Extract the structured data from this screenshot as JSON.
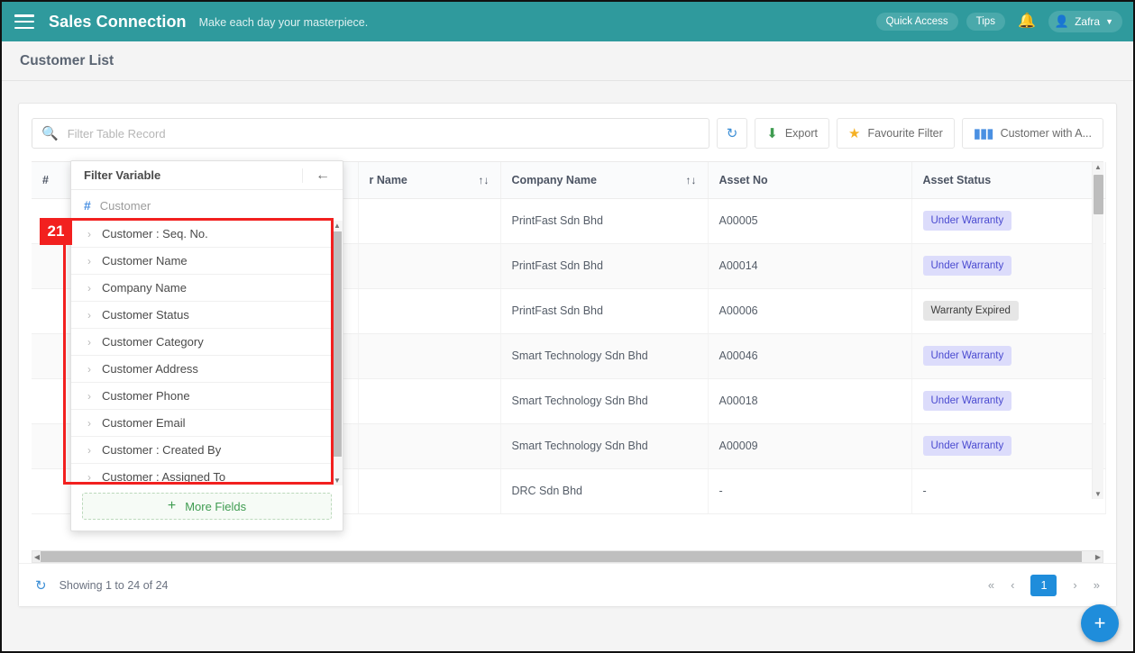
{
  "topbar": {
    "menu_icon": "hamburger-icon",
    "brand": "Sales Connection",
    "tagline": "Make each day your masterpiece.",
    "quick_access": "Quick Access",
    "tips": "Tips",
    "bell_icon": "bell-icon",
    "user_name": "Zafra",
    "teal": "#2f9a9d"
  },
  "page": {
    "title": "Customer List"
  },
  "toolbar": {
    "search_placeholder": "Filter Table Record",
    "search_value": "",
    "refresh_label": "",
    "export_label": "Export",
    "favourite_filter_label": "Favourite Filter",
    "columns_label": "Customer with A..."
  },
  "table": {
    "columns": [
      {
        "label": "#",
        "sortable": false
      },
      {
        "label": "",
        "sortable": false
      },
      {
        "label": "",
        "sortable": false
      },
      {
        "label": "r Name",
        "sortable": true
      },
      {
        "label": "Company Name",
        "sortable": true
      },
      {
        "label": "Asset No",
        "sortable": false
      },
      {
        "label": "Asset Status",
        "sortable": false
      }
    ],
    "sort_glyph": "↑↓",
    "rows": [
      {
        "hash": "",
        "icon": "",
        "a": "",
        "b": "",
        "name": "",
        "company": "PrintFast Sdn Bhd",
        "asset_no": "A00005",
        "status": "Under Warranty",
        "status_type": "warranty"
      },
      {
        "hash": "",
        "icon": "",
        "a": "",
        "b": "",
        "name": "",
        "company": "PrintFast Sdn Bhd",
        "asset_no": "A00014",
        "status": "Under Warranty",
        "status_type": "warranty"
      },
      {
        "hash": "",
        "icon": "",
        "a": "",
        "b": "",
        "name": "",
        "company": "PrintFast Sdn Bhd",
        "asset_no": "A00006",
        "status": "Warranty Expired",
        "status_type": "expired"
      },
      {
        "hash": "",
        "icon": "external-link-icon",
        "a": "",
        "b": "",
        "name": "",
        "company": "Smart Technology Sdn Bhd",
        "asset_no": "A00046",
        "status": "Under Warranty",
        "status_type": "warranty"
      },
      {
        "hash": "",
        "icon": "",
        "a": "",
        "b": "",
        "name": "",
        "company": "Smart Technology Sdn Bhd",
        "asset_no": "A00018",
        "status": "Under Warranty",
        "status_type": "warranty"
      },
      {
        "hash": "",
        "icon": "",
        "a": "",
        "b": "",
        "name": "",
        "company": "Smart Technology Sdn Bhd",
        "asset_no": "A00009",
        "status": "Under Warranty",
        "status_type": "warranty"
      },
      {
        "hash": "",
        "icon": "external-link-icon",
        "a": "",
        "b": "",
        "name": "",
        "company": "DRC Sdn Bhd",
        "asset_no": "-",
        "status": "-",
        "status_type": "plain"
      }
    ]
  },
  "footer": {
    "refresh_icon": "refresh-icon",
    "showing": "Showing 1 to 24 of 24",
    "first": "«",
    "prev": "‹",
    "current_page": "1",
    "next": "›",
    "last": "»"
  },
  "filter_dropdown": {
    "title": "Filter Variable",
    "back_icon": "back-arrow-icon",
    "section_icon": "hash-icon",
    "section_label": "Customer",
    "items": [
      {
        "label": "Customer : Seq. No."
      },
      {
        "label": "Customer Name"
      },
      {
        "label": "Company Name"
      },
      {
        "label": "Customer Status"
      },
      {
        "label": "Customer Category"
      },
      {
        "label": "Customer Address"
      },
      {
        "label": "Customer Phone"
      },
      {
        "label": "Customer Email"
      },
      {
        "label": "Customer : Created By"
      },
      {
        "label": "Customer : Assigned To"
      }
    ],
    "more_fields": "More Fields"
  },
  "annotation": {
    "number": "21",
    "color": "#f2201f"
  },
  "fab": {
    "label": "+"
  }
}
